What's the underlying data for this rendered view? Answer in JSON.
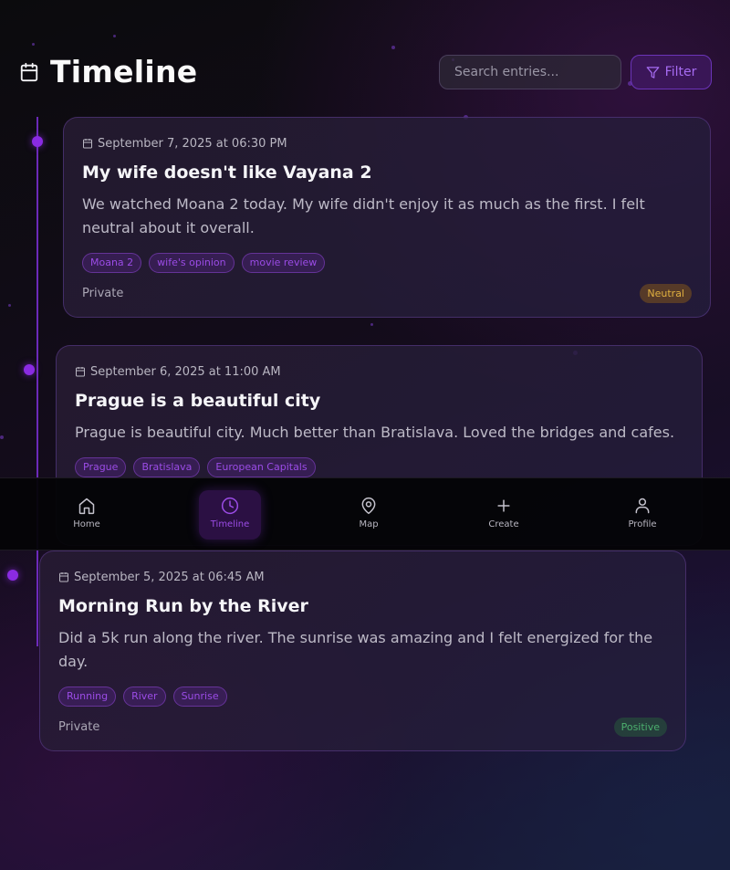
{
  "header": {
    "title": "Timeline",
    "search_placeholder": "Search entries...",
    "filter_label": "Filter"
  },
  "entries": [
    {
      "date": "September 7, 2025 at 06:30 PM",
      "title": "My wife doesn't like Vayana 2",
      "body": "We watched Moana 2 today. My wife didn't enjoy it as much as the first. I felt neutral about it overall.",
      "tags": [
        "Moana 2",
        "wife's opinion",
        "movie review"
      ],
      "privacy": "Private",
      "mood": "Neutral"
    },
    {
      "date": "September 6, 2025 at 11:00 AM",
      "title": "Prague is a beautiful city",
      "body": "Prague is beautiful city. Much better than Bratislava. Loved the bridges and cafes.",
      "tags": [
        "Prague",
        "Bratislava",
        "European Capitals"
      ]
    },
    {
      "date": "September 5, 2025 at 06:45 AM",
      "title": "Morning Run by the River",
      "body": "Did a 5k run along the river. The sunrise was amazing and I felt energized for the day.",
      "tags": [
        "Running",
        "River",
        "Sunrise"
      ],
      "privacy": "Private",
      "mood": "Positive"
    }
  ],
  "nav": {
    "items": [
      {
        "label": "Home",
        "icon": "home-icon"
      },
      {
        "label": "Timeline",
        "icon": "clock-icon",
        "active": true
      },
      {
        "label": "Map",
        "icon": "map-pin-icon"
      },
      {
        "label": "Create",
        "icon": "plus-icon"
      },
      {
        "label": "Profile",
        "icon": "user-icon"
      }
    ]
  },
  "colors": {
    "accent": "#8a2be2",
    "neutral_badge": "#e0b040",
    "positive_badge": "#4caf6e"
  }
}
